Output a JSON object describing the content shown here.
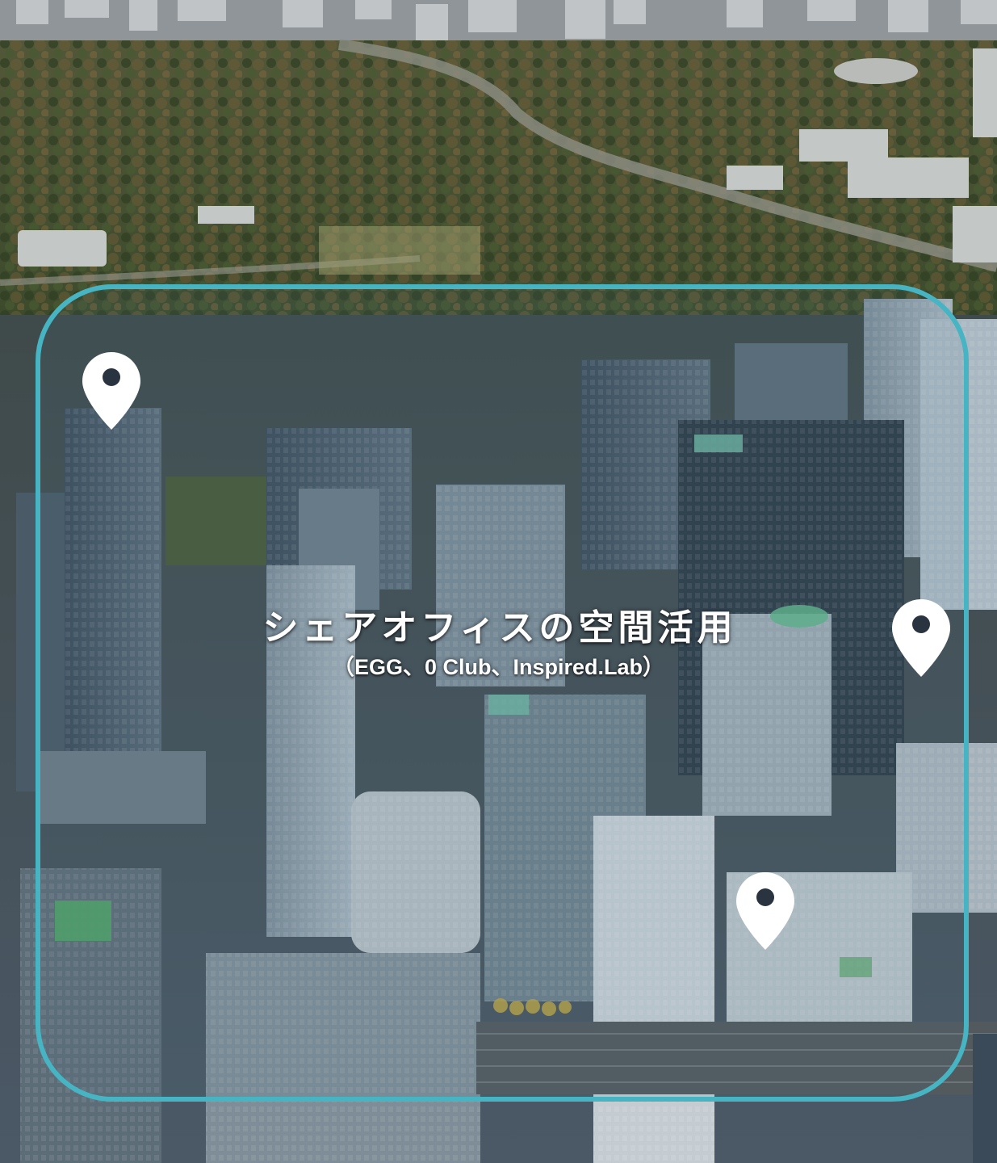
{
  "map": {
    "title": "シェアオフィスの空間活用",
    "subtitle": "（EGG、0 Club、Inspired.Lab）",
    "frame_color": "#46b4c2",
    "marker_color": "#ffffff",
    "markers": [
      {
        "icon": "map-pin-icon"
      },
      {
        "icon": "map-pin-icon"
      },
      {
        "icon": "map-pin-icon"
      }
    ]
  }
}
